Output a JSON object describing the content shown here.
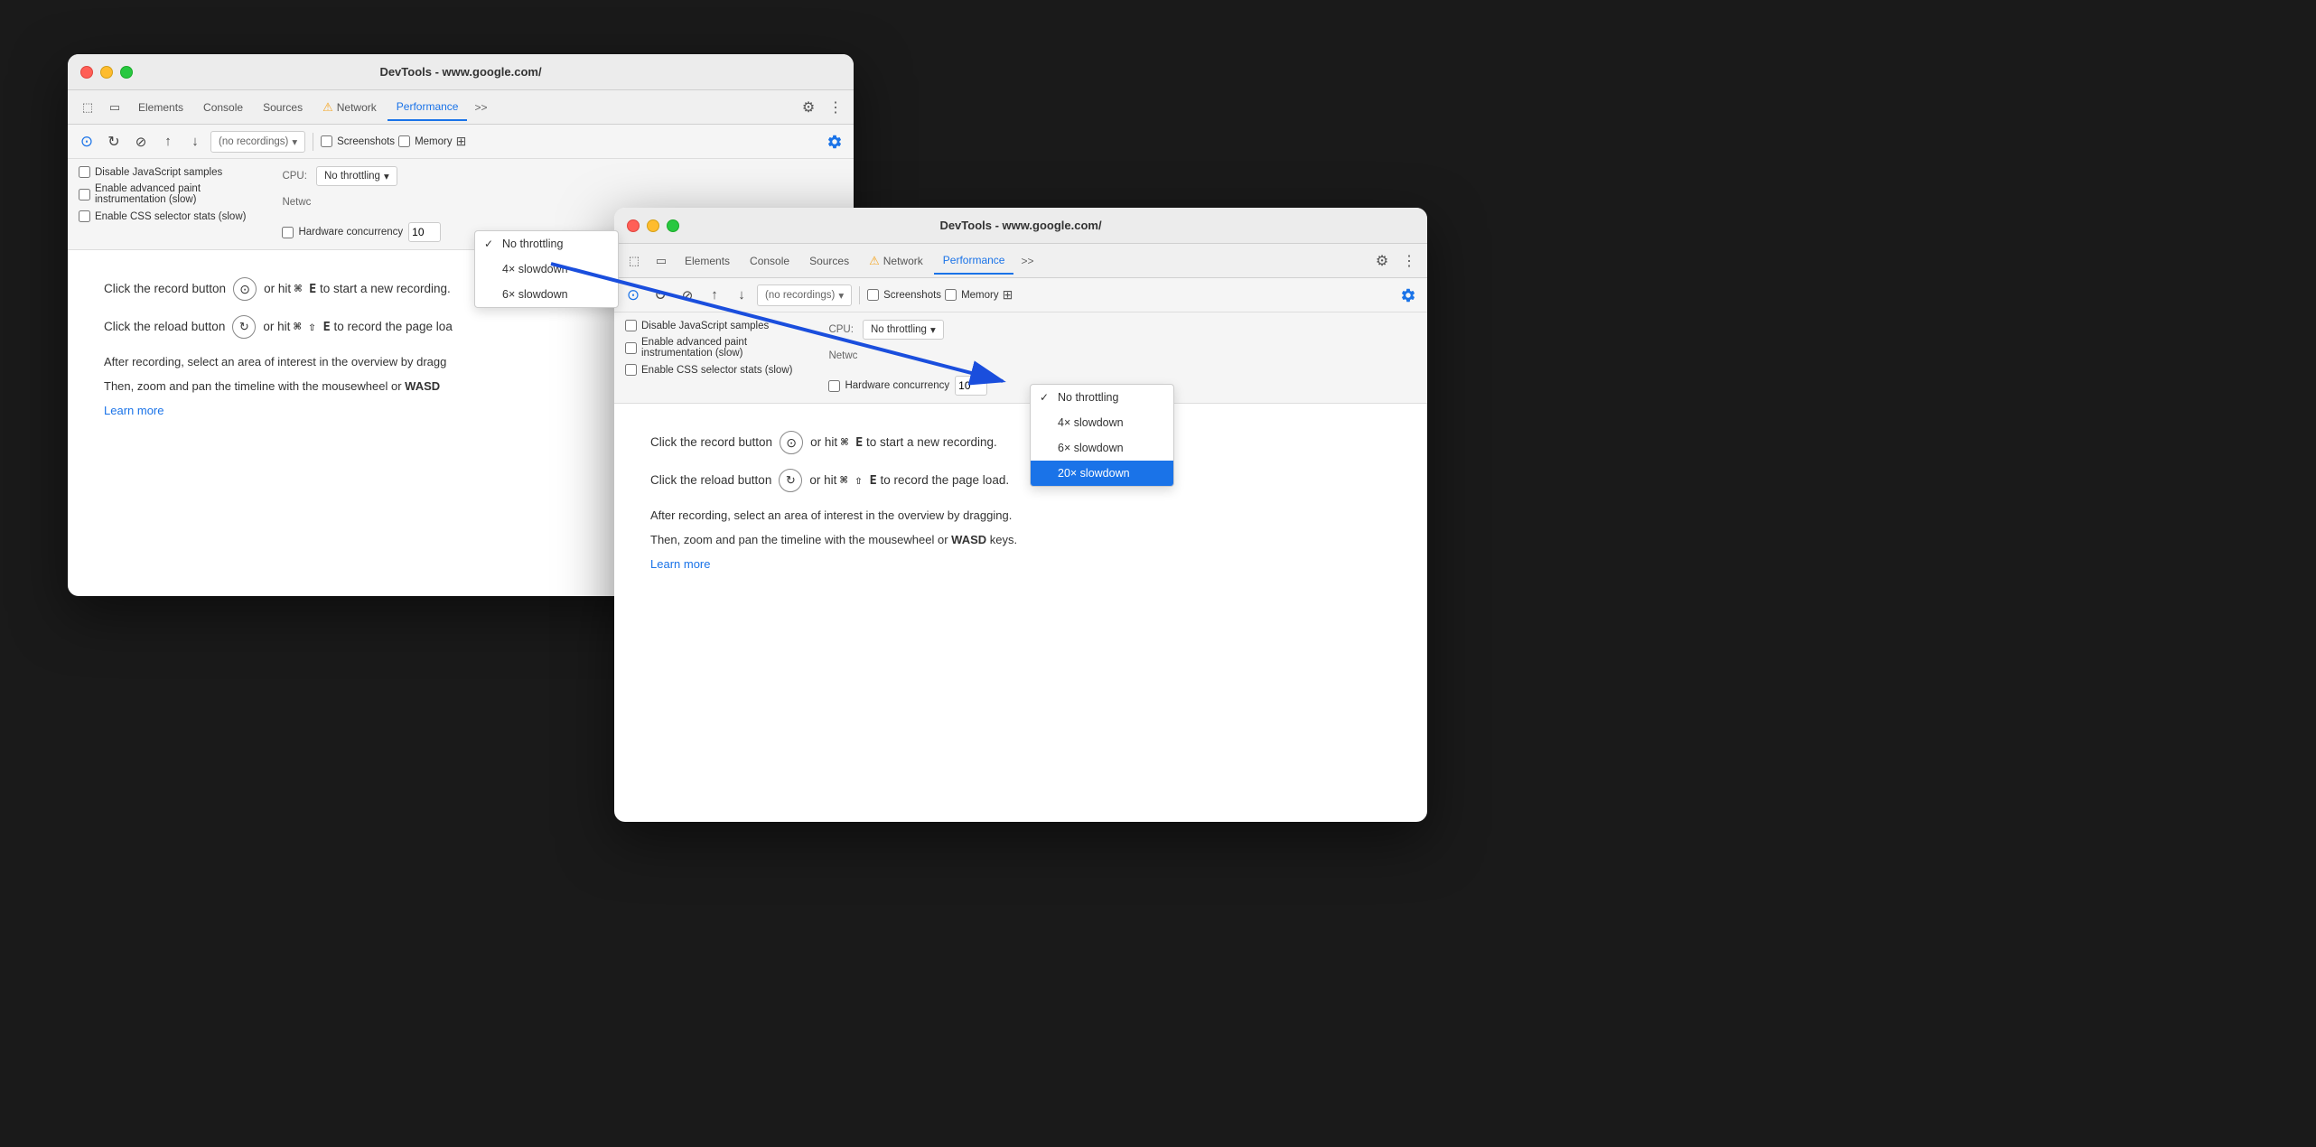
{
  "window1": {
    "title": "DevTools - www.google.com/",
    "tabs": [
      "Elements",
      "Console",
      "Sources",
      "Network",
      "Performance",
      ">>"
    ],
    "toolbar": {
      "recordings_placeholder": "(no recordings)",
      "screenshots_label": "Screenshots",
      "memory_label": "Memory"
    },
    "settings": {
      "cpu_label": "CPU:",
      "network_label": "Netwc",
      "hardware_label": "Hardware concurrency",
      "hardware_value": "10",
      "cpu_throttle_selected": "No throttling"
    },
    "checkboxes": [
      "Disable JavaScript samples",
      "Enable advanced paint instrumentation (slow)",
      "Enable CSS selector stats (slow)"
    ],
    "cpu_dropdown": {
      "items": [
        "No throttling",
        "4× slowdown",
        "6× slowdown"
      ],
      "selected": "No throttling"
    },
    "instructions": {
      "record_text": "Click the record button",
      "record_suffix": "or hit ⌘ E to start a new recording.",
      "reload_text": "Click the reload button",
      "reload_suffix": "or hit ⌘ ⇧ E to record the page load.",
      "desc1": "After recording, select an area of interest in the overview by dragg",
      "desc2": "Then, zoom and pan the timeline with the mousewheel or WASD",
      "learn_more": "Learn more"
    }
  },
  "window2": {
    "title": "DevTools - www.google.com/",
    "tabs": [
      "Elements",
      "Console",
      "Sources",
      "Network",
      "Performance",
      ">>"
    ],
    "toolbar": {
      "recordings_placeholder": "(no recordings)",
      "screenshots_label": "Screenshots",
      "memory_label": "Memory"
    },
    "settings": {
      "cpu_label": "CPU:",
      "network_label": "Netwc",
      "hardware_label": "Hardware concurrency",
      "hardware_value": "10",
      "cpu_throttle_selected": "No throttling"
    },
    "checkboxes": [
      "Disable JavaScript samples",
      "Enable advanced paint instrumentation (slow)",
      "Enable CSS selector stats (slow)"
    ],
    "cpu_dropdown": {
      "items": [
        "No throttling",
        "4× slowdown",
        "6× slowdown",
        "20× slowdown"
      ],
      "highlighted": "20× slowdown"
    },
    "instructions": {
      "record_text": "Click the record button",
      "record_suffix": "or hit ⌘ E to start a new recording.",
      "reload_text": "Click the reload button",
      "reload_suffix": "or hit ⌘ ⇧ E to record the page load.",
      "desc1": "After recording, select an area of interest in the overview by dragging.",
      "desc2": "Then, zoom and pan the timeline with the mousewheel or WASD keys.",
      "learn_more": "Learn more"
    }
  },
  "icons": {
    "record": "⊙",
    "reload": "↻",
    "stop": "⊘",
    "upload": "↑",
    "download": "↓",
    "settings": "⚙",
    "more": "⋮",
    "chevron": "▾",
    "selector": "⬚",
    "cursor": "↖",
    "warning": "⚠"
  }
}
